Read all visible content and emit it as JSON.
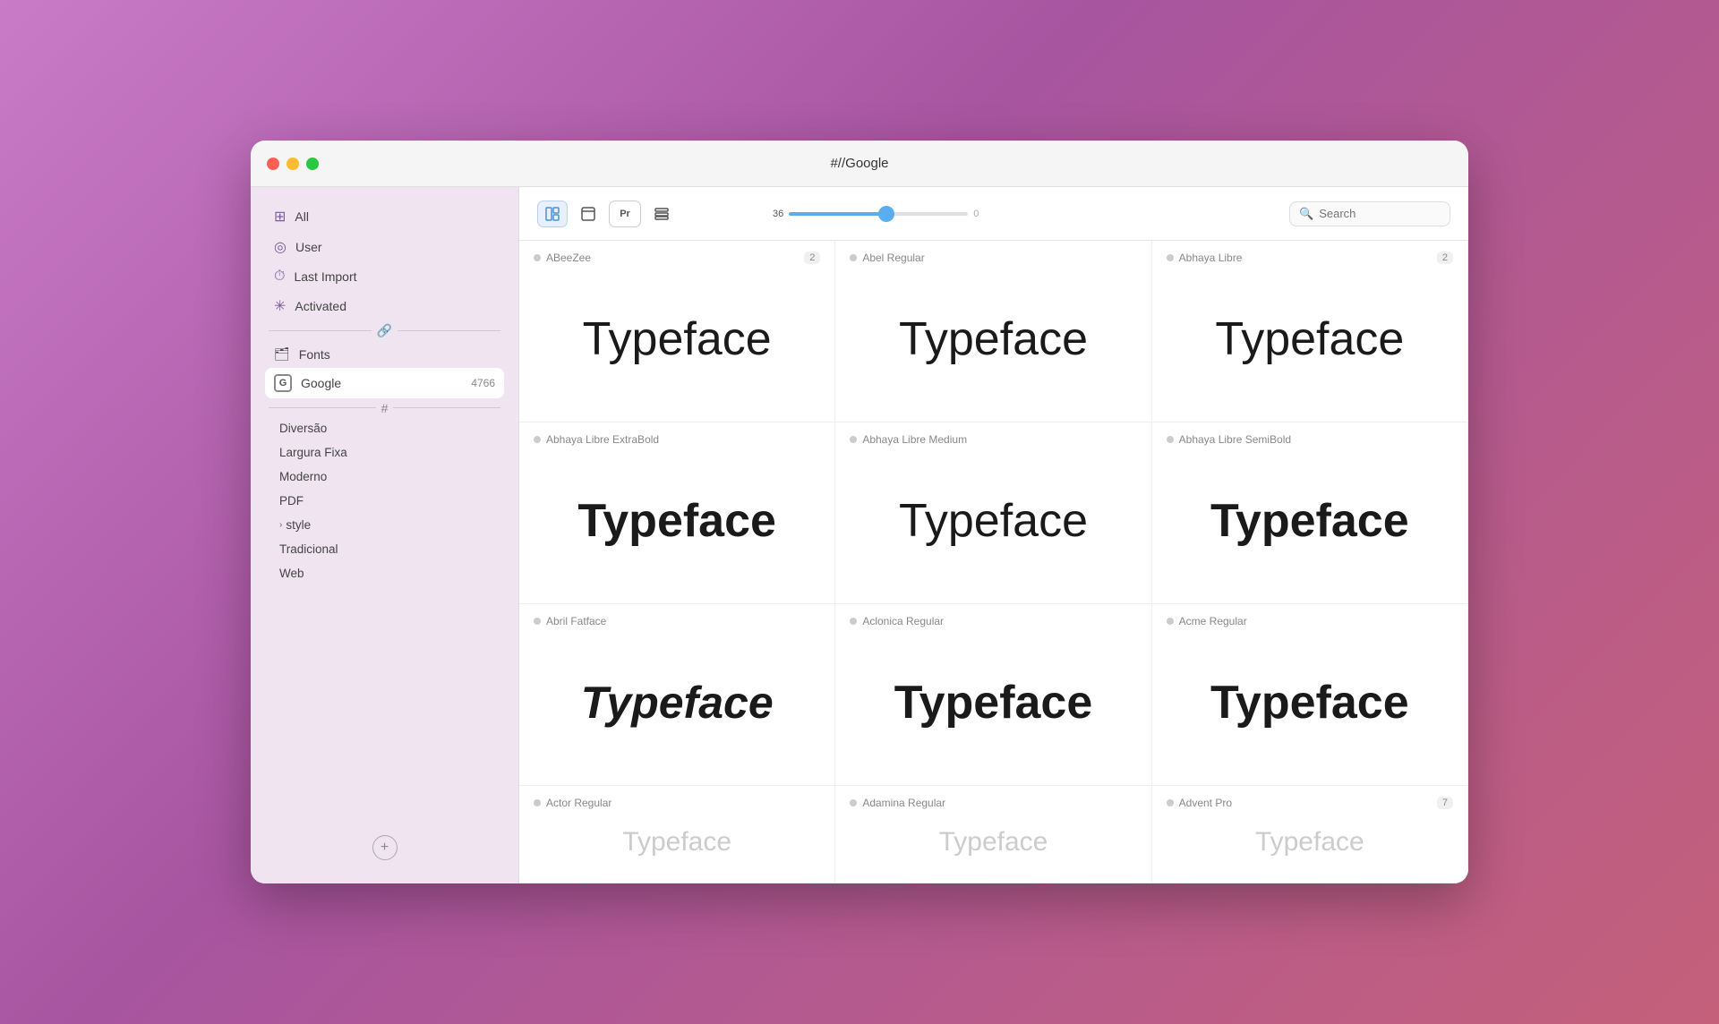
{
  "window": {
    "title": "#//Google"
  },
  "sidebar": {
    "nav_items": [
      {
        "id": "all",
        "label": "All",
        "icon": "⊞"
      },
      {
        "id": "user",
        "label": "User",
        "icon": "◎"
      },
      {
        "id": "last-import",
        "label": "Last Import",
        "icon": "⏱"
      },
      {
        "id": "activated",
        "label": "Activated",
        "icon": "✳"
      }
    ],
    "divider1_icon": "🔗",
    "sections": [
      {
        "id": "fonts",
        "label": "Fonts",
        "icon": "🗂",
        "count": ""
      }
    ],
    "google_item": {
      "label": "Google",
      "icon": "G",
      "count": "4766"
    },
    "divider2_icon": "#",
    "tags": [
      {
        "label": "Diversão",
        "expandable": false
      },
      {
        "label": "Largura Fixa",
        "expandable": false
      },
      {
        "label": "Moderno",
        "expandable": false
      },
      {
        "label": "PDF",
        "expandable": false
      },
      {
        "label": "style",
        "expandable": true
      },
      {
        "label": "Tradicional",
        "expandable": false
      },
      {
        "label": "Web",
        "expandable": false
      }
    ],
    "add_button_label": "+"
  },
  "toolbar": {
    "view_icons": [
      {
        "id": "panel-view",
        "symbol": "▤",
        "active": true
      },
      {
        "id": "browser-view",
        "symbol": "⬜",
        "active": false
      },
      {
        "id": "preview-view",
        "symbol": "Pr",
        "active": false
      },
      {
        "id": "list-view",
        "symbol": "☰",
        "active": false
      }
    ],
    "size_value": "36",
    "size_min": "0",
    "size_slider_percent": 55,
    "search_placeholder": "Search"
  },
  "font_cards": [
    {
      "id": "abeezee",
      "name": "ABeeZee",
      "count": "2",
      "preview": "Typeface",
      "style": "normal"
    },
    {
      "id": "abel-regular",
      "name": "Abel Regular",
      "count": "",
      "preview": "Typeface",
      "style": "normal"
    },
    {
      "id": "abhaya-libre",
      "name": "Abhaya Libre",
      "count": "2",
      "preview": "Typeface",
      "style": "normal"
    },
    {
      "id": "abhaya-libre-extrabold",
      "name": "Abhaya Libre ExtraBold",
      "count": "",
      "preview": "Typeface",
      "style": "extrabold"
    },
    {
      "id": "abhaya-libre-medium",
      "name": "Abhaya Libre Medium",
      "count": "",
      "preview": "Typeface",
      "style": "normal"
    },
    {
      "id": "abhaya-libre-semibold",
      "name": "Abhaya Libre SemiBold",
      "count": "",
      "preview": "Typeface",
      "style": "semibold"
    },
    {
      "id": "abril-fatface",
      "name": "Abril Fatface",
      "count": "",
      "preview": "Typeface",
      "style": "abril"
    },
    {
      "id": "aclonica-regular",
      "name": "Aclonica Regular",
      "count": "",
      "preview": "Typeface",
      "style": "aclonica"
    },
    {
      "id": "acme-regular",
      "name": "Acme Regular",
      "count": "",
      "preview": "Typeface",
      "style": "normal"
    },
    {
      "id": "actor-regular",
      "name": "Actor Regular",
      "count": "",
      "preview": "Typeface",
      "style": "normal"
    },
    {
      "id": "adamina-regular",
      "name": "Adamina Regular",
      "count": "",
      "preview": "Typeface",
      "style": "normal"
    },
    {
      "id": "advent-pro",
      "name": "Advent Pro",
      "count": "7",
      "preview": "Typeface",
      "style": "normal"
    }
  ]
}
